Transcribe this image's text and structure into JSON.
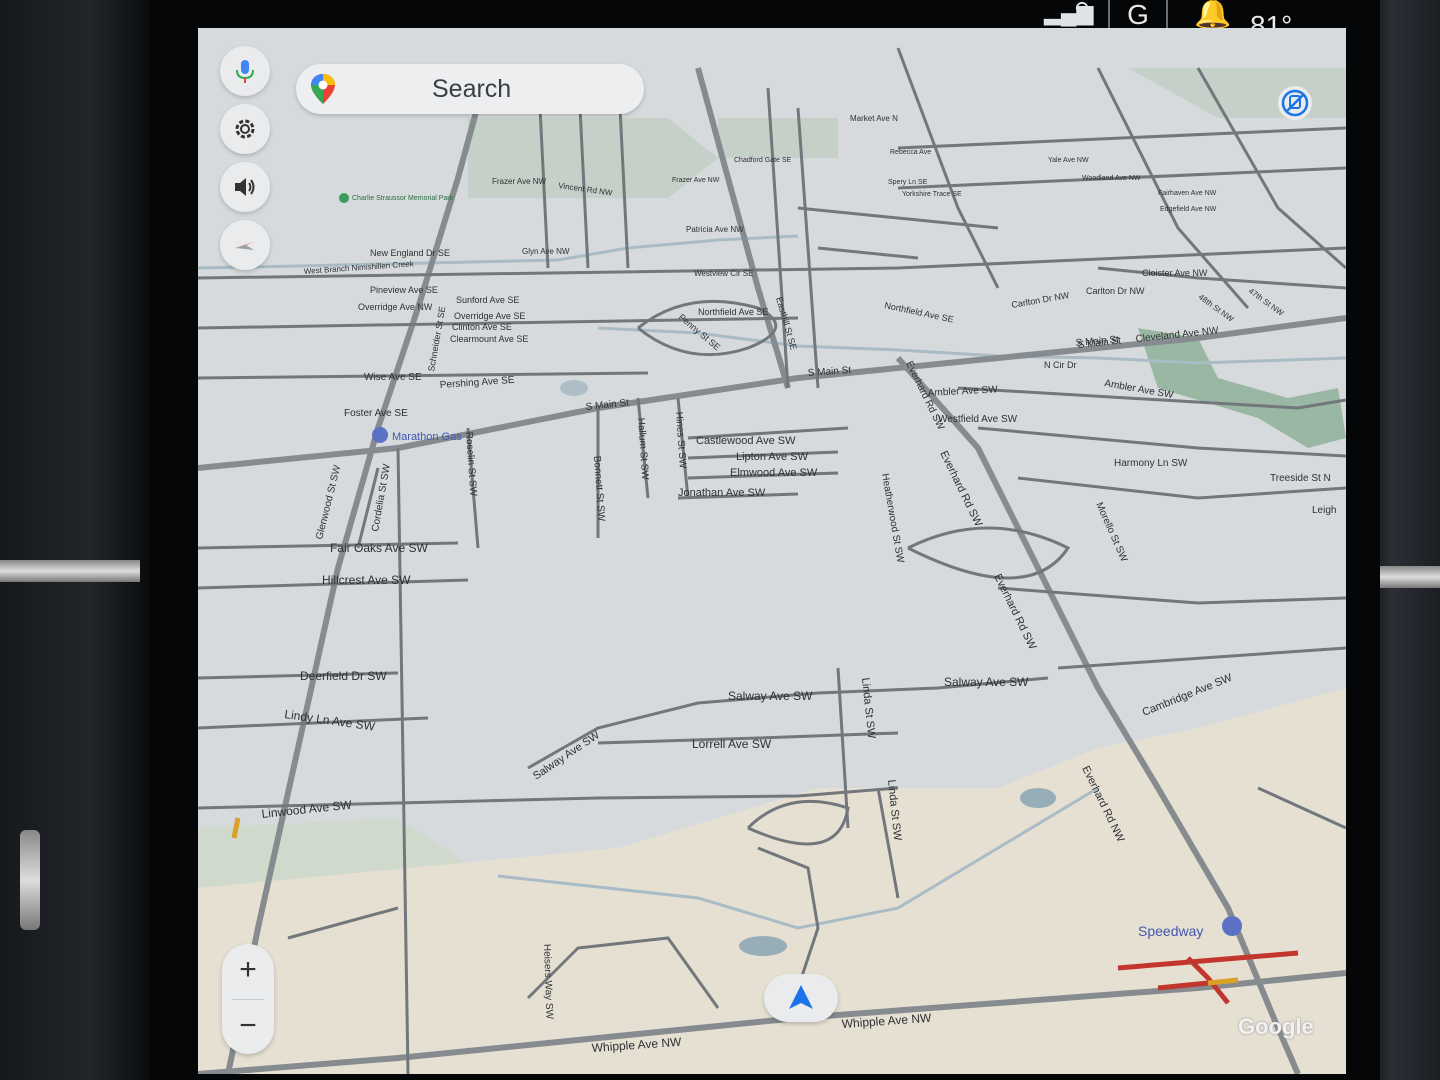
{
  "status": {
    "temperature": "81°",
    "profile_letter": "G"
  },
  "search": {
    "label": "Search"
  },
  "zoom": {
    "plus": "+",
    "minus": "−"
  },
  "logo": "Google",
  "pois": [
    {
      "label": "Marathon Gas"
    },
    {
      "label": "Speedway"
    },
    {
      "label": "Charlie Straussor Memorial Park"
    }
  ],
  "streets": [
    "S Main St",
    "S Main St",
    "S Main St",
    "Everhard Rd SW",
    "Everhard Rd SW",
    "Everhard Rd SW",
    "Everhard Rd NW",
    "Salway Ave SW",
    "Salway Ave SW",
    "Salway Ave SW",
    "Lorrell Ave SW",
    "Linda St SW",
    "Linda St SW",
    "Linwood Ave SW",
    "Lindy Ln Ave SW",
    "Deerfield Dr SW",
    "Hillcrest Ave SW",
    "Fair Oaks Ave SW",
    "Glenwood St SW",
    "Cordelia St SW",
    "Roselin St SW",
    "Bonnett St SW",
    "Hallum St SW",
    "Hines St SW",
    "Castlewood Ave SW",
    "Lipton Ave SW",
    "Elmwood Ave SW",
    "Jonathan Ave SW",
    "Heatherwood St SW",
    "Ambler Ave SW",
    "Ambler Ave SW",
    "Westfield Ave SW",
    "Harmony Ln SW",
    "Morello St SW",
    "Cambridge Ave SW",
    "Treeside St N",
    "Leigh",
    "Whipple Ave NW",
    "Whipple Ave NW",
    "Heisers Way SW",
    "Pershing Ave SE",
    "Wise Ave SE",
    "Foster Ave SE",
    "Pineview Ave SE",
    "Overridge Ave NW",
    "Sunford Ave SE",
    "Overridge Ave SE",
    "Clinton Ave SE",
    "Clearmount Ave SE",
    "Schneider St SE",
    "New England Dr SE",
    "West Branch Nimishillen Creek",
    "Glyn Ave NW",
    "Westview Cir SE",
    "Northfield Ave SE",
    "Northfield Ave SE",
    "Penny St SE",
    "Easthill St SE",
    "Patricia Ave NW",
    "Frazer Ave NW",
    "Vincent Rd NW",
    "Carlton Dr NW",
    "Carlton Dr NW",
    "Cloister Ave NW",
    "Cleveland Ave NW",
    "S Main St",
    "N Cir Dr",
    "48th St NW",
    "47th St NW",
    "Edgefield Ave NW",
    "Fairhaven Ave NW",
    "Woodland Ave NW",
    "Market Ave N",
    "Yale Ave NW",
    "Frazer Ave NW",
    "Chadford Gate SE",
    "Rebecca Ave",
    "Yorkshire Trace SE",
    "Spery Ln SE"
  ],
  "colors": {
    "map_bg": "#d7dadd",
    "road": "#6f7479",
    "major_road": "#8a8f94",
    "park": "#9ab7a3",
    "land": "#e6e0d3",
    "water": "#97aeb8",
    "traffic_red": "#c2362d",
    "traffic_yellow": "#d9a227",
    "accent_blue": "#1a73e8"
  }
}
